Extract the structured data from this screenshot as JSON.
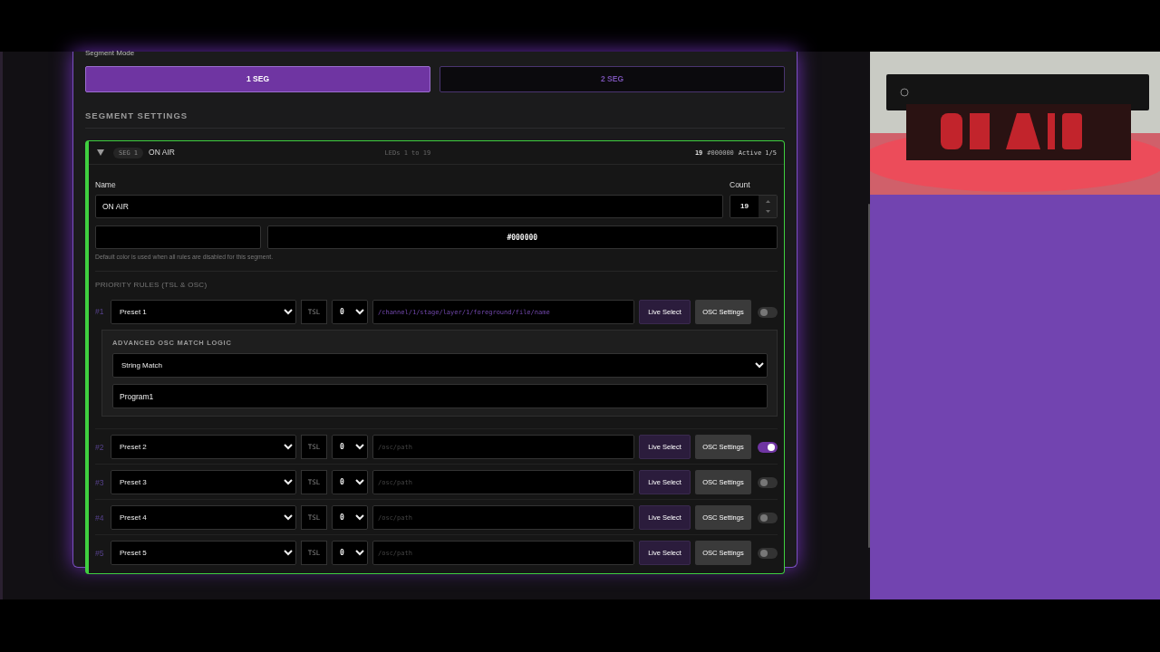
{
  "segment_mode": {
    "label": "Segment Mode",
    "options": [
      {
        "label": "1 SEG",
        "selected": true
      },
      {
        "label": "2 SEG",
        "selected": false
      }
    ]
  },
  "section_title": "SEGMENT SETTINGS",
  "segment": {
    "expanded": true,
    "tag": "SEG 1",
    "name": "ON AIR",
    "range": "LEDs 1 to 19",
    "summary_count": "19",
    "summary_color": "#000000",
    "summary_active": "Active 1/5",
    "name_label": "Name",
    "name_value": "ON AIR",
    "count_label": "Count",
    "count_value": "19",
    "color_value": "#000000",
    "color_hint": "Default color is used when all rules are disabled for this segment.",
    "rules_title": "PRIORITY RULES (TSL & OSC)",
    "rules": [
      {
        "index": "#1",
        "preset": "Preset 1",
        "protocol": "TSL",
        "channel": "0",
        "path": "/channel/1/stage/layer/1/foreground/file/name",
        "live_label": "Live Select",
        "osc_label": "OSC Settings",
        "enabled": false,
        "advanced": {
          "title": "ADVANCED OSC MATCH LOGIC",
          "mode": "String Match",
          "value": "Program1"
        }
      },
      {
        "index": "#2",
        "preset": "Preset 2",
        "protocol": "TSL",
        "channel": "0",
        "placeholder": "/osc/path",
        "live_label": "Live Select",
        "osc_label": "OSC Settings",
        "enabled": true
      },
      {
        "index": "#3",
        "preset": "Preset 3",
        "protocol": "TSL",
        "channel": "0",
        "placeholder": "/osc/path",
        "live_label": "Live Select",
        "osc_label": "OSC Settings",
        "enabled": false
      },
      {
        "index": "#4",
        "preset": "Preset 4",
        "protocol": "TSL",
        "channel": "0",
        "placeholder": "/osc/path",
        "live_label": "Live Select",
        "osc_label": "OSC Settings",
        "enabled": false
      },
      {
        "index": "#5",
        "preset": "Preset 5",
        "protocol": "TSL",
        "channel": "0",
        "placeholder": "/osc/path",
        "live_label": "Live Select",
        "osc_label": "OSC Settings",
        "enabled": false
      }
    ]
  }
}
